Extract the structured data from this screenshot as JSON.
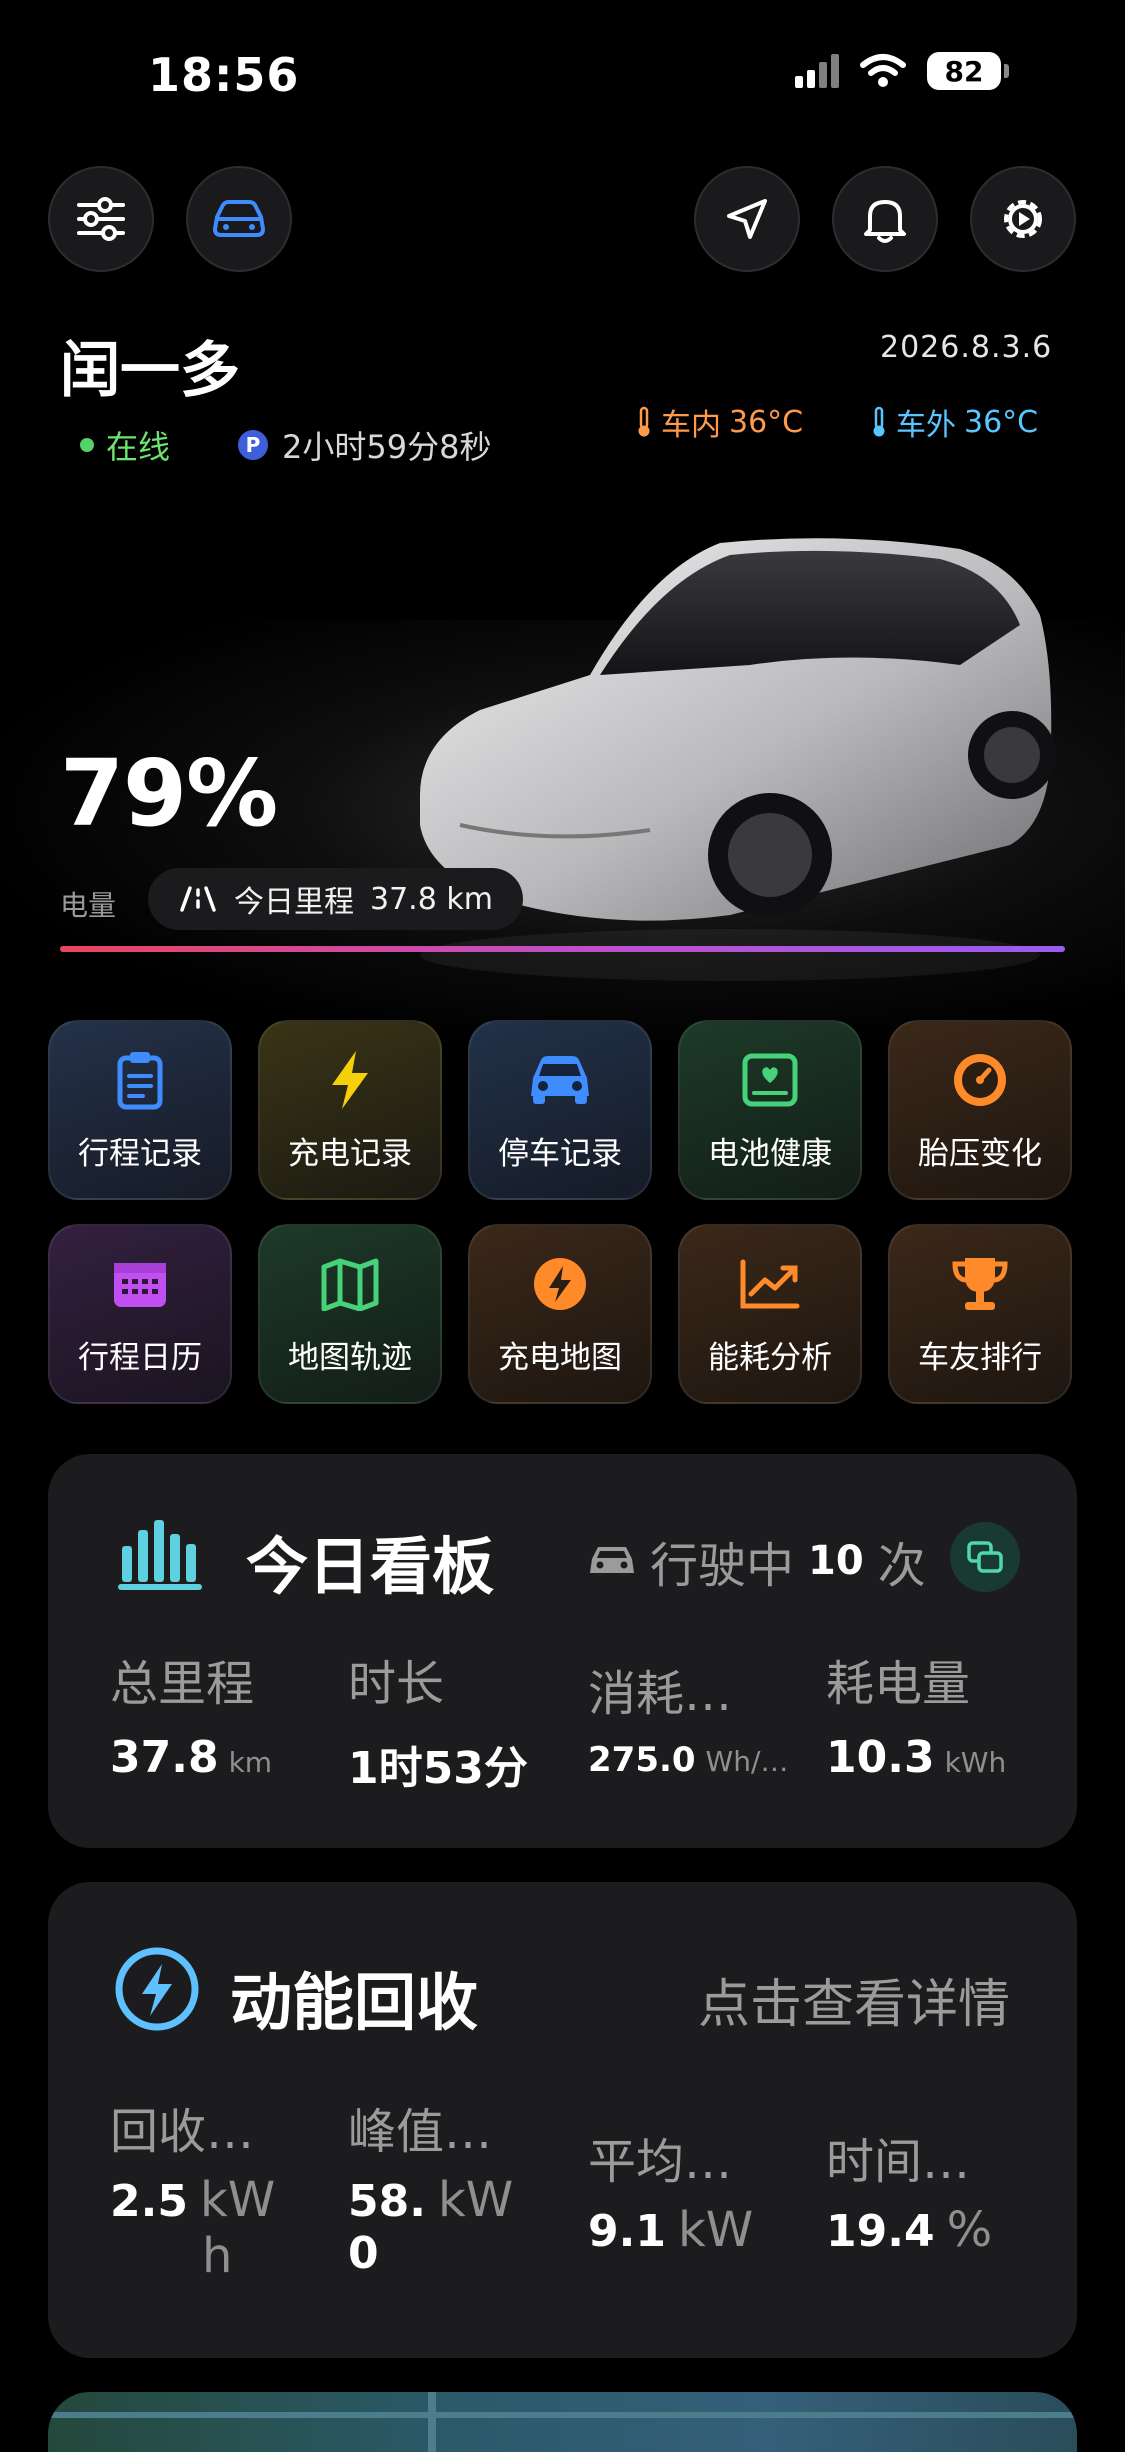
{
  "status_bar": {
    "time": "18:56",
    "battery": "82"
  },
  "header": {
    "name": "闰一多",
    "online": "在线",
    "parked_badge": "P",
    "parked_duration": "2小时59分8秒",
    "date": "2026.8.3.6",
    "temp_inside_label": "车内",
    "temp_inside": "36°C",
    "temp_outside_label": "车外",
    "temp_outside": "36°C"
  },
  "vehicle": {
    "battery_percent": "79%",
    "battery_label": "电量",
    "battery_level": 0.79,
    "mileage_label": "今日里程",
    "mileage_value": "37.8 km"
  },
  "tiles": [
    {
      "label": "行程记录",
      "icon": "clipboard-icon",
      "color": "#3f8cff"
    },
    {
      "label": "充电记录",
      "icon": "lightning-icon",
      "color": "#f5d10a"
    },
    {
      "label": "停车记录",
      "icon": "car-icon",
      "color": "#3f8cff"
    },
    {
      "label": "电池健康",
      "icon": "battery-health-icon",
      "color": "#46d27a"
    },
    {
      "label": "胎压变化",
      "icon": "gauge-icon",
      "color": "#ff8a2a"
    },
    {
      "label": "行程日历",
      "icon": "calendar-icon",
      "color": "#c04ef0"
    },
    {
      "label": "地图轨迹",
      "icon": "map-icon",
      "color": "#46d27a"
    },
    {
      "label": "充电地图",
      "icon": "charge-map-icon",
      "color": "#ff8a2a"
    },
    {
      "label": "能耗分析",
      "icon": "trend-chart-icon",
      "color": "#ff8a2a"
    },
    {
      "label": "车友排行",
      "icon": "trophy-icon",
      "color": "#ff8a2a"
    }
  ],
  "dashboard": {
    "title": "今日看板",
    "driving_label": "行驶中",
    "driving_count": "10",
    "driving_unit": "次",
    "stats": [
      {
        "label": "总里程",
        "value": "37.8",
        "unit": "km"
      },
      {
        "label": "时长",
        "value": "1时53分",
        "unit": ""
      },
      {
        "label": "消耗…",
        "value": "275.0",
        "unit": "Wh/…"
      },
      {
        "label": "耗电量",
        "value": "10.3",
        "unit": "kWh"
      }
    ]
  },
  "regen": {
    "title": "动能回收",
    "detail_link": "点击查看详情",
    "stats": [
      {
        "label": "回收…",
        "value": "2.5",
        "unit": "kW",
        "unit2": "h"
      },
      {
        "label": "峰值…",
        "value": "58.",
        "unit": "kW",
        "value2": "0"
      },
      {
        "label": "平均…",
        "value": "9.1",
        "unit": "kW"
      },
      {
        "label": "时间…",
        "value": "19.4",
        "unit": "%"
      }
    ]
  },
  "colors": {
    "background": "#000000",
    "card": "#1c1c1e",
    "online": "#55d16a",
    "temp_inside": "#ff9a4a",
    "temp_outside": "#58c6ff",
    "accent_blue": "#3f8cff"
  }
}
